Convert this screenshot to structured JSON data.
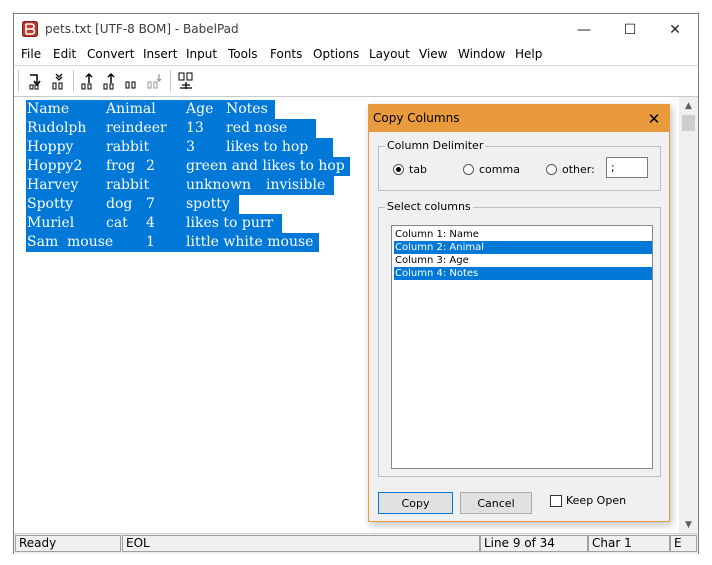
{
  "window": {
    "title": "pets.txt [UTF-8 BOM] - BabelPad",
    "minimize": "—",
    "maximize": "☐",
    "close": "✕"
  },
  "menus": [
    "File",
    "Edit",
    "Convert",
    "Insert",
    "Input",
    "Tools",
    "Fonts",
    "Options",
    "Layout",
    "View",
    "Window",
    "Help"
  ],
  "toolbar": {
    "icons": [
      "move-line-down-icon",
      "move-lines-down-icon",
      "move-line-up-icon",
      "move-lines-up-icon",
      "move-up-disabled-icon",
      "move-down-disabled-icon",
      "insert-column-icon"
    ]
  },
  "editor": {
    "rows": [
      [
        "Name",
        "Animal",
        "Age",
        "Notes"
      ],
      [
        "Rudolph",
        "reindeer",
        "13",
        "red nose"
      ],
      [
        "Hoppy",
        "rabbit",
        "3",
        "likes to hop"
      ],
      [
        "Hoppy2",
        "frog",
        "2",
        "green and likes to hop"
      ],
      [
        "Harvey",
        "rabbit",
        "unknown",
        "invisible"
      ],
      [
        "Spotty",
        "dog",
        "7",
        "spotty"
      ],
      [
        "Muriel",
        "cat",
        "4",
        "likes to purr"
      ],
      [
        "Sam",
        "mouse",
        "1",
        "little white mouse"
      ]
    ]
  },
  "status": {
    "ready": "Ready",
    "eol": "EOL",
    "line": "Line 9 of 34",
    "char": "Char 1",
    "extra": "E"
  },
  "dialog": {
    "title": "Copy Columns",
    "close": "✕",
    "delimiter_group": "Column Delimiter",
    "delimiters": [
      {
        "label": "tab",
        "selected": true
      },
      {
        "label": "comma",
        "selected": false
      },
      {
        "label": "other:",
        "selected": false
      }
    ],
    "other_value": ";",
    "select_group": "Select columns",
    "columns": [
      {
        "label": "Column 1: Name",
        "selected": false
      },
      {
        "label": "Column 2: Animal",
        "selected": true
      },
      {
        "label": "Column 3: Age",
        "selected": false
      },
      {
        "label": "Column 4: Notes",
        "selected": true
      }
    ],
    "copy_label": "Copy",
    "cancel_label": "Cancel",
    "keep_open_label": "Keep Open",
    "keep_open_checked": false
  },
  "colors": {
    "selection": "#0078d7",
    "dialog_accent": "#e89a3c"
  }
}
